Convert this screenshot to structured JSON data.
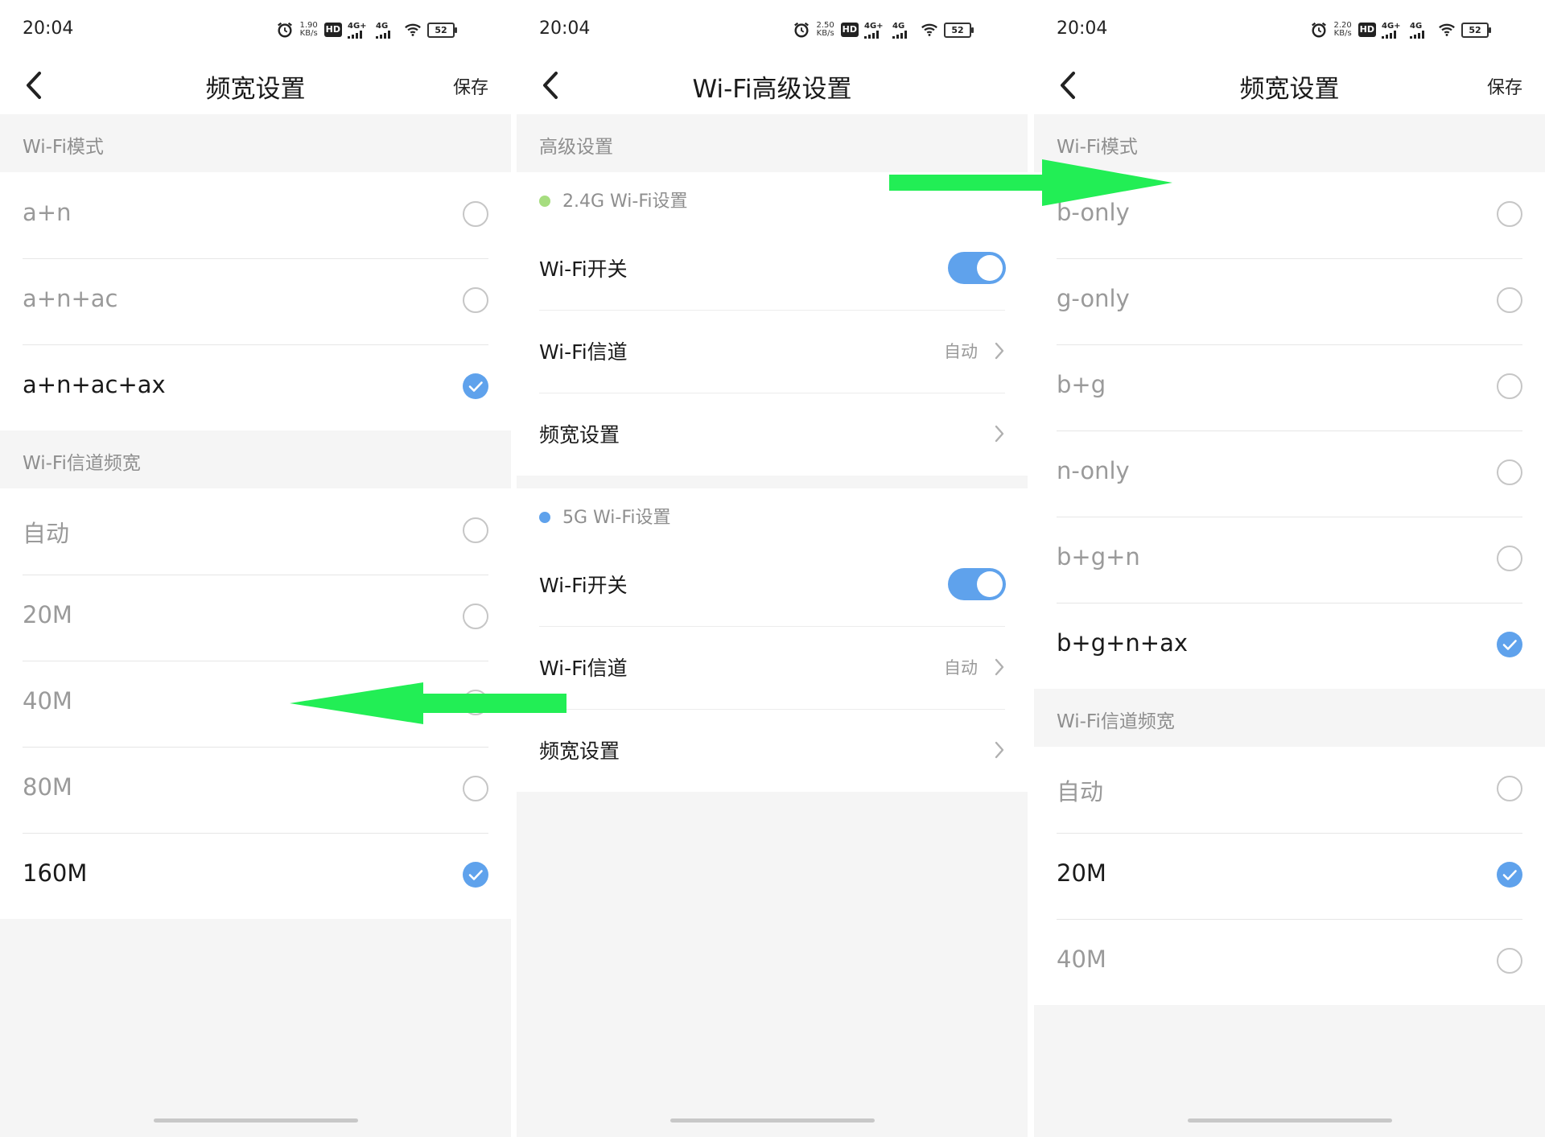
{
  "status_time": "20:04",
  "status_icons": {
    "alarm_icon": "alarm-clock-icon",
    "hd_label": "HD",
    "network1": "4G+",
    "network2": "4G",
    "wifi_icon": "wifi-icon",
    "battery": "52",
    "speed_unit": "KB/s"
  },
  "screens": {
    "left": {
      "speed": "1.90",
      "title": "频宽设置",
      "save_label": "保存",
      "sections": [
        {
          "header": "Wi-Fi模式",
          "options": [
            {
              "label": "a+n",
              "selected": false
            },
            {
              "label": "a+n+ac",
              "selected": false
            },
            {
              "label": "a+n+ac+ax",
              "selected": true
            }
          ]
        },
        {
          "header": "Wi-Fi信道频宽",
          "options": [
            {
              "label": "自动",
              "selected": false
            },
            {
              "label": "20M",
              "selected": false
            },
            {
              "label": "40M",
              "selected": false
            },
            {
              "label": "80M",
              "selected": false
            },
            {
              "label": "160M",
              "selected": true
            }
          ]
        }
      ]
    },
    "mid": {
      "speed": "2.50",
      "title": "Wi-Fi高级设置",
      "section_header": "高级设置",
      "groups": [
        {
          "label": "2.4G Wi-Fi设置",
          "dot_color": "#a6dd7f",
          "switch_label": "Wi-Fi开关",
          "switch_on": true,
          "channel_label": "Wi-Fi信道",
          "channel_value": "自动",
          "bandwidth_label": "频宽设置"
        },
        {
          "label": "5G Wi-Fi设置",
          "dot_color": "#5fa2ec",
          "switch_label": "Wi-Fi开关",
          "switch_on": true,
          "channel_label": "Wi-Fi信道",
          "channel_value": "自动",
          "bandwidth_label": "频宽设置"
        }
      ]
    },
    "right": {
      "speed": "2.20",
      "title": "频宽设置",
      "save_label": "保存",
      "sections": [
        {
          "header": "Wi-Fi模式",
          "options": [
            {
              "label": "b-only",
              "selected": false
            },
            {
              "label": "g-only",
              "selected": false
            },
            {
              "label": "b+g",
              "selected": false
            },
            {
              "label": "n-only",
              "selected": false
            },
            {
              "label": "b+g+n",
              "selected": false
            },
            {
              "label": "b+g+n+ax",
              "selected": true
            }
          ]
        },
        {
          "header": "Wi-Fi信道频宽",
          "options": [
            {
              "label": "自动",
              "selected": false
            },
            {
              "label": "20M",
              "selected": true
            },
            {
              "label": "40M",
              "selected": false
            }
          ]
        }
      ]
    }
  },
  "colors": {
    "accent": "#5fa2ec",
    "annotation_arrow": "#22ee55"
  }
}
